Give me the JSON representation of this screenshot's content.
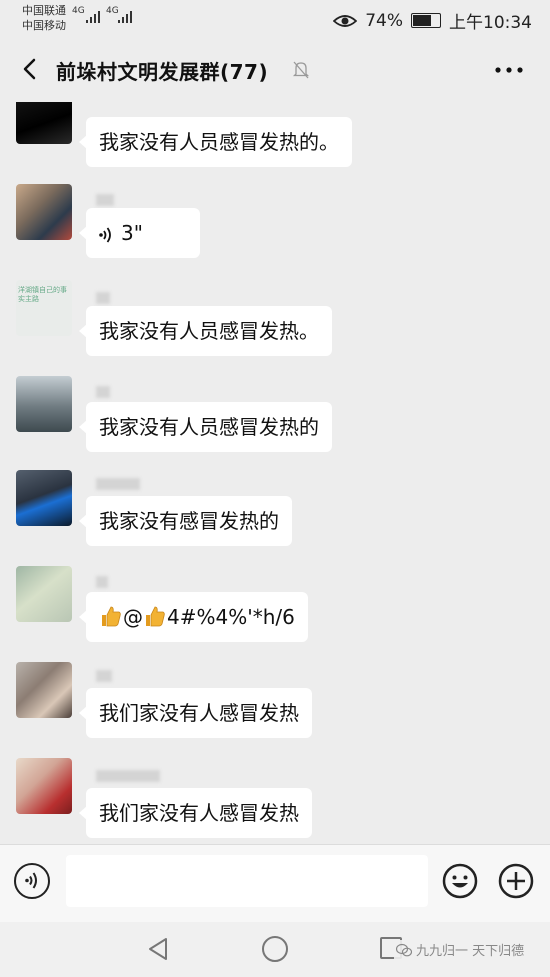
{
  "status": {
    "carrier1": "中国联通",
    "carrier2": "中国移动",
    "net1": "4G",
    "net2": "4G",
    "battery": "74%",
    "battery_level": 0.74,
    "time": "上午10:34"
  },
  "header": {
    "title": "前垛村文明发展群(77)"
  },
  "messages": [
    {
      "text": "我家没有人员感冒发热的。"
    },
    {
      "voice_duration": "3\""
    },
    {
      "text": "我家没有人员感冒发热。"
    },
    {
      "text": "我家没有人员感冒发热的"
    },
    {
      "text": "我家没有感冒发热的"
    },
    {
      "text_at": "@",
      "text_tail": "4#%4%'*h/6"
    },
    {
      "text": "我们家没有人感冒发热"
    },
    {
      "text": "我们家没有人感冒发热"
    }
  ],
  "avatar_text": {
    "m5_line1": "洋湖镇自己的事",
    "m5_line2": "实主路"
  },
  "navbar": {
    "watermark": "九九归一 天下归德"
  },
  "colors": {
    "background": "#ededed",
    "bubble": "#ffffff",
    "thumb": "#f2b233"
  }
}
